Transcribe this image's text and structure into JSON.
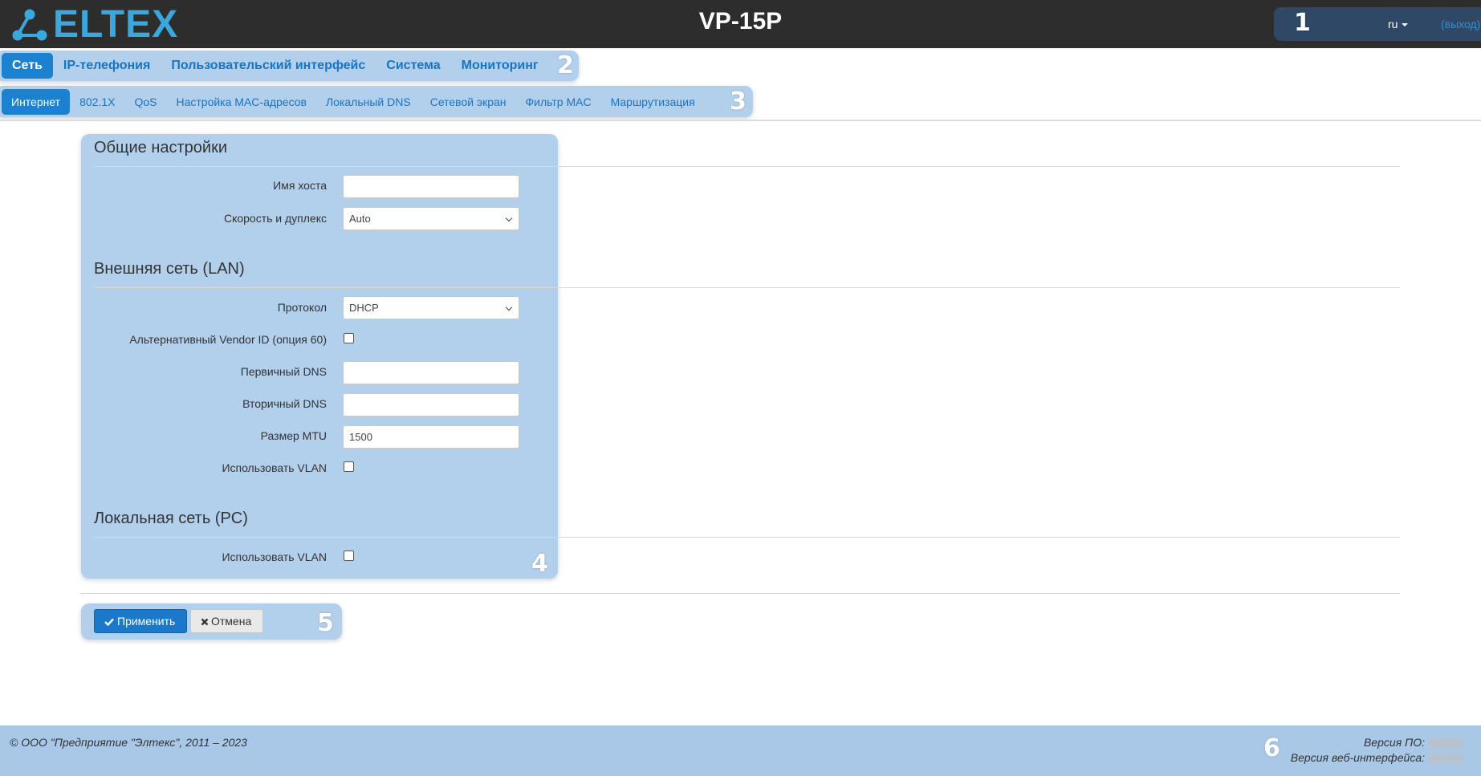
{
  "header": {
    "logo_text": "ELTEX",
    "device_title": "VP-15P",
    "language": "ru",
    "logout_label": "(выход)"
  },
  "callouts": {
    "c1": "1",
    "c2": "2",
    "c3": "3",
    "c4": "4",
    "c5": "5",
    "c6": "6"
  },
  "main_nav": {
    "items": [
      {
        "label": "Сеть",
        "active": true
      },
      {
        "label": "IP-телефония"
      },
      {
        "label": "Пользовательский интерфейс"
      },
      {
        "label": "Система"
      },
      {
        "label": "Мониторинг"
      }
    ]
  },
  "sub_nav": {
    "items": [
      {
        "label": "Интернет",
        "active": true
      },
      {
        "label": "802.1X"
      },
      {
        "label": "QoS"
      },
      {
        "label": "Настройка MAC-адресов"
      },
      {
        "label": "Локальный DNS"
      },
      {
        "label": "Сетевой экран"
      },
      {
        "label": "Фильтр MAC"
      },
      {
        "label": "Маршрутизация"
      }
    ]
  },
  "general": {
    "title": "Общие настройки",
    "hostname_label": "Имя хоста",
    "hostname_value": "",
    "speed_label": "Скорость и дуплекс",
    "speed_value": "Auto"
  },
  "wan": {
    "title": "Внешняя сеть (LAN)",
    "protocol_label": "Протокол",
    "protocol_value": "DHCP",
    "vendor_label": "Альтернативный Vendor ID (опция 60)",
    "vendor_checked": false,
    "dns1_label": "Первичный DNS",
    "dns1_value": "",
    "dns2_label": "Вторичный DNS",
    "dns2_value": "",
    "mtu_label": "Размер MTU",
    "mtu_value": "1500",
    "vlan_label": "Использовать VLAN",
    "vlan_checked": false
  },
  "lan": {
    "title": "Локальная сеть (PC)",
    "vlan_label": "Использовать VLAN",
    "vlan_checked": false
  },
  "actions": {
    "apply_label": "Применить",
    "cancel_label": "Отмена"
  },
  "footer": {
    "copyright": "© ООО \"Предприятие \"Элтекс\", 2011 – 2023",
    "fw_version_label": "Версия ПО:",
    "web_version_label": "Версия веб-интерфейса:"
  },
  "colors": {
    "header_bg": "#2d2d2d",
    "accent": "#1c81cf",
    "highlight": "#76aade",
    "logo": "#3aa8dc"
  }
}
